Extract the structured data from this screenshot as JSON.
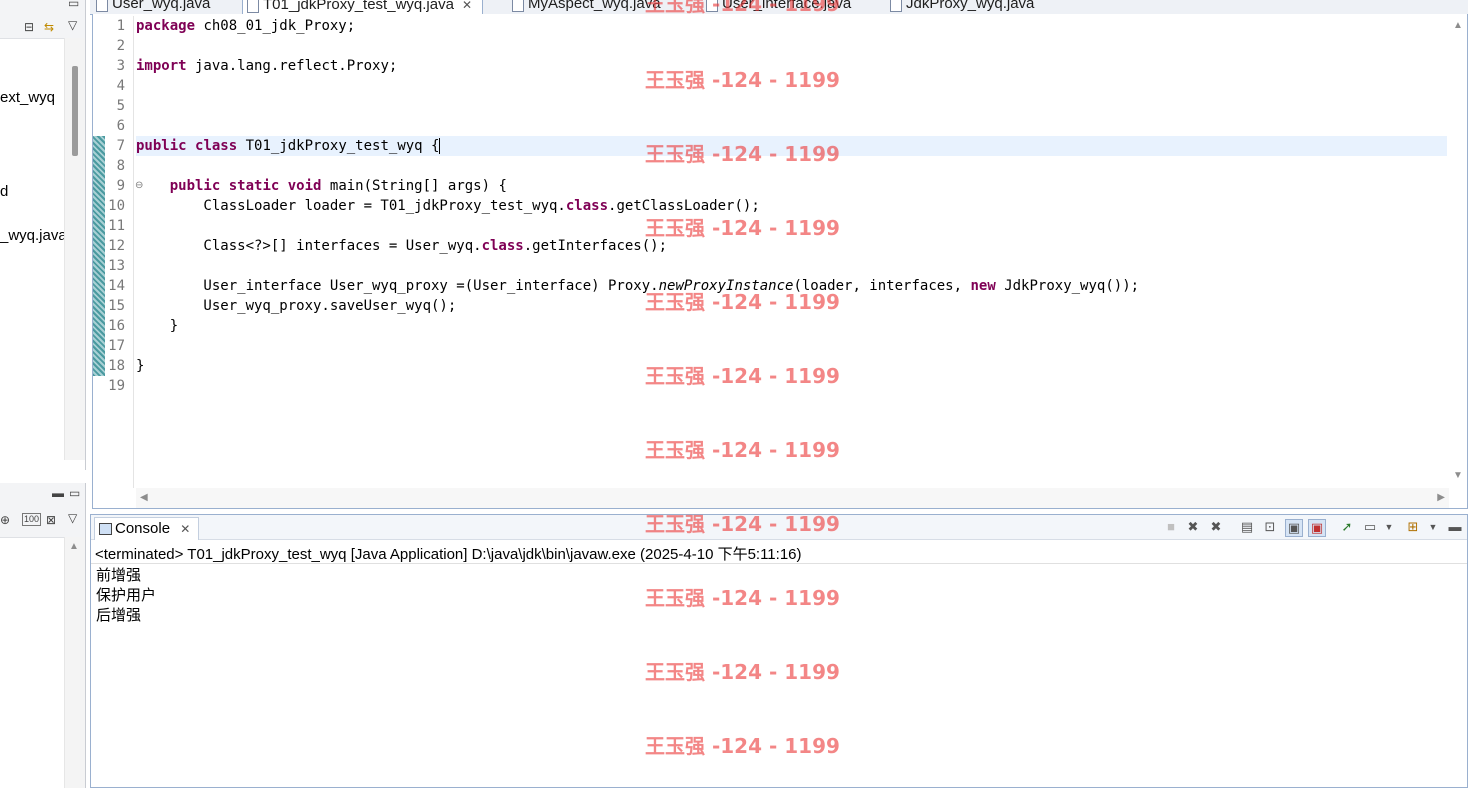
{
  "editor": {
    "tabs": [
      {
        "label": "User_wyq.java",
        "active": false
      },
      {
        "label": "T01_jdkProxy_test_wyq.java",
        "active": true
      },
      {
        "label": "MyAspect_wyq.java",
        "active": false
      },
      {
        "label": "User_interface.java",
        "active": false
      },
      {
        "label": "JdkProxy_wyq.java",
        "active": false
      }
    ],
    "line_numbers": [
      "1",
      "2",
      "3",
      "4",
      "5",
      "6",
      "7",
      "8",
      "9",
      "10",
      "11",
      "12",
      "13",
      "14",
      "15",
      "16",
      "17",
      "18",
      "19"
    ],
    "current_line": 7,
    "code": [
      [
        {
          "t": "package",
          "k": "kw"
        },
        {
          "t": " ch08_01_jdk_Proxy;"
        }
      ],
      [],
      [
        {
          "t": "import",
          "k": "kw"
        },
        {
          "t": " java.lang.reflect.Proxy;"
        }
      ],
      [],
      [],
      [],
      [
        {
          "t": "public",
          "k": "kw"
        },
        {
          "t": " "
        },
        {
          "t": "class",
          "k": "kw"
        },
        {
          "t": " T01_jdkProxy_test_wyq {"
        }
      ],
      [],
      [
        {
          "t": "    "
        },
        {
          "t": "public",
          "k": "kw"
        },
        {
          "t": " "
        },
        {
          "t": "static",
          "k": "kw"
        },
        {
          "t": " "
        },
        {
          "t": "void",
          "k": "kw"
        },
        {
          "t": " main(String[] args) {"
        }
      ],
      [
        {
          "t": "        ClassLoader loader = T01_jdkProxy_test_wyq."
        },
        {
          "t": "class",
          "k": "kw"
        },
        {
          "t": ".getClassLoader();"
        }
      ],
      [],
      [
        {
          "t": "        Class<?>[] interfaces = User_wyq."
        },
        {
          "t": "class",
          "k": "kw"
        },
        {
          "t": ".getInterfaces();"
        }
      ],
      [],
      [
        {
          "t": "        User_interface User_wyq_proxy =(User_interface) Proxy."
        },
        {
          "t": "newProxyInstance",
          "k": "it"
        },
        {
          "t": "(loader, interfaces, "
        },
        {
          "t": "new",
          "k": "kw"
        },
        {
          "t": " JdkProxy_wyq());"
        }
      ],
      [
        {
          "t": "        User_wyq_proxy.saveUser_wyq();"
        }
      ],
      [
        {
          "t": "    }"
        }
      ],
      [],
      [
        {
          "t": "}"
        }
      ],
      []
    ]
  },
  "left_panel": {
    "tree_items": [
      "ext_wyq",
      "d",
      "_wyq.java"
    ]
  },
  "console": {
    "tab_label": "Console",
    "status": "<terminated> T01_jdkProxy_test_wyq [Java Application] D:\\java\\jdk\\bin\\javaw.exe (2025-4-10 下午5:11:16)",
    "output": [
      "前增强",
      "保护用户",
      "后增强"
    ]
  },
  "watermark": {
    "text": "王玉强 -124 - 1199"
  },
  "colors": {
    "keyword": "#7f0055",
    "current_line": "#e8f2fe",
    "watermark": "#eb3c3c"
  }
}
